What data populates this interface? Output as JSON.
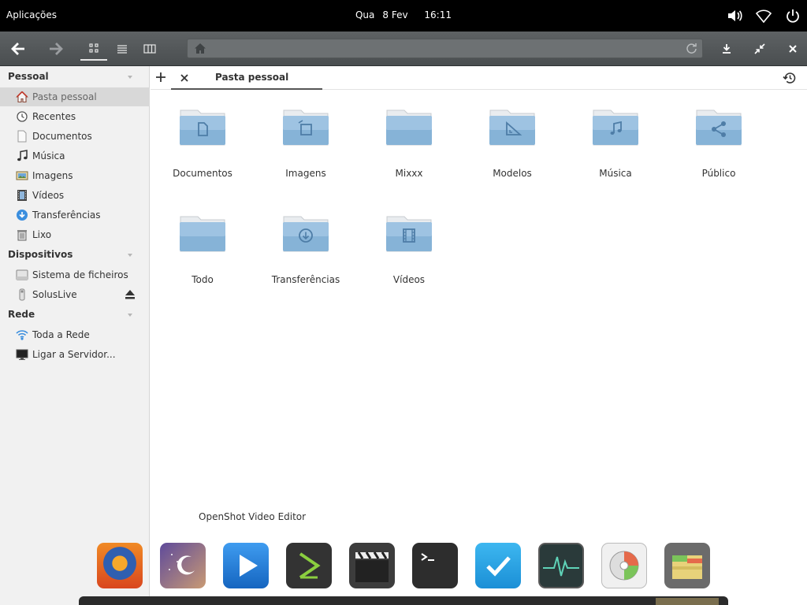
{
  "panel": {
    "applications": "Aplicações",
    "day": "Qua",
    "date": "8 Fev",
    "time": "16:11",
    "indicators": [
      "volume-icon",
      "wifi-icon",
      "power-icon"
    ]
  },
  "headerbar": {
    "back_icon": "arrow-left-icon",
    "forward_icon": "arrow-right-icon",
    "view_modes": [
      "grid-view-icon",
      "list-view-icon",
      "column-view-icon"
    ],
    "active_view": "grid",
    "location_icon": "home-icon",
    "location_text": "",
    "actions": [
      "reload-icon",
      "download-icon",
      "unmaximize-icon",
      "close-icon"
    ]
  },
  "sidebar": {
    "sections": [
      {
        "heading": "Pessoal",
        "items": [
          {
            "label": "Pasta pessoal",
            "icon": "home-icon",
            "selected": true
          },
          {
            "label": "Recentes",
            "icon": "clock-icon"
          },
          {
            "label": "Documentos",
            "icon": "document-icon"
          },
          {
            "label": "Música",
            "icon": "music-note-icon"
          },
          {
            "label": "Imagens",
            "icon": "image-icon"
          },
          {
            "label": "Vídeos",
            "icon": "film-icon"
          },
          {
            "label": "Transferências",
            "icon": "download-circle-icon"
          },
          {
            "label": "Lixo",
            "icon": "trash-icon"
          }
        ]
      },
      {
        "heading": "Dispositivos",
        "items": [
          {
            "label": "Sistema de ficheiros",
            "icon": "harddrive-icon"
          },
          {
            "label": "SolusLive",
            "icon": "usb-drive-icon",
            "eject": true
          }
        ]
      },
      {
        "heading": "Rede",
        "items": [
          {
            "label": "Toda a Rede",
            "icon": "network-wifi-icon"
          },
          {
            "label": "Ligar a Servidor...",
            "icon": "monitor-icon"
          }
        ]
      }
    ]
  },
  "tabs": {
    "new_tab_icon": "plus-icon",
    "close_tab_icon": "close-icon",
    "active_tab": "Pasta pessoal",
    "history_icon": "history-icon"
  },
  "folders": [
    {
      "label": "Documentos",
      "emblem": "document-icon"
    },
    {
      "label": "Imagens",
      "emblem": "image-icon"
    },
    {
      "label": "Mixxx",
      "emblem": ""
    },
    {
      "label": "Modelos",
      "emblem": "template-icon"
    },
    {
      "label": "Música",
      "emblem": "music-note-icon"
    },
    {
      "label": "Público",
      "emblem": "share-icon"
    },
    {
      "label": "Todo",
      "emblem": ""
    },
    {
      "label": "Transferências",
      "emblem": "download-circle-icon"
    },
    {
      "label": "Vídeos",
      "emblem": "film-icon"
    }
  ],
  "dock": {
    "tooltip": "OpenShot Video Editor",
    "apps": [
      "firefox-icon",
      "night-sky-app-icon",
      "media-player-icon",
      "code-editor-icon",
      "openshot-clapperboard-icon",
      "terminal-icon",
      "tasks-checkmark-icon",
      "system-monitor-icon",
      "disk-utility-icon",
      "file-archive-icon"
    ]
  },
  "colors": {
    "panel_bg": "#000000",
    "headerbar_bg": "#54585a",
    "sidebar_bg": "#f1f1f1",
    "sidebar_selected": "#d8d8d8",
    "folder_blue": "#7aa7cc"
  }
}
